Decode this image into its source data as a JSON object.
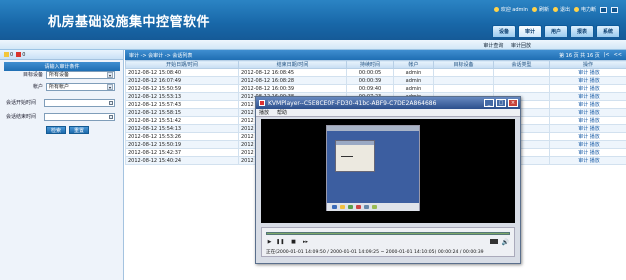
{
  "app": {
    "title": "机房基础设施集中控管软件"
  },
  "topbar": {
    "welcome": "欢迎 admin",
    "refresh": "刷新",
    "logout": "退出",
    "power": "电力断"
  },
  "tabs": [
    "设备",
    "审计",
    "用户",
    "报表",
    "系统"
  ],
  "subnav": {
    "item1": "审计查询",
    "item2": "审计回放"
  },
  "left": {
    "badge1": "0",
    "badge2": "0",
    "panel_title": "请输入审计条件",
    "device_label": "目标设备",
    "device_value": "所有设备",
    "account_label": "帐户",
    "account_value": "所有帐户",
    "start_label": "会话开始时间",
    "end_label": "会话结束时间",
    "search_btn": "检索",
    "reset_btn": "重置"
  },
  "main": {
    "breadcrumb": "审计 -> 会审计 -> 会话列表",
    "pager": "第 16 页 共 16 页",
    "first": "|<",
    "prev": "<<"
  },
  "table": {
    "headers": [
      "开始日期/时间",
      "结束日期/时间",
      "持续时间",
      "帐户",
      "目标设备",
      "会话类型",
      "操作"
    ],
    "rows": [
      [
        "2012-08-12 15:08:40",
        "2012-08-12 16:08:45",
        "00:00:05",
        "admin",
        "",
        "",
        "审计 播放"
      ],
      [
        "2012-08-12 16:07:49",
        "2012-08-12 16:08:28",
        "00:00:39",
        "admin",
        "",
        "",
        "审计 播放"
      ],
      [
        "2012-08-12 15:50:59",
        "2012-08-12 16:00:39",
        "00:09:40",
        "admin",
        "",
        "",
        "审计 播放"
      ],
      [
        "2012-08-12 15:53:13",
        "2012-08-12 16:00:38",
        "00:07:23",
        "admin",
        "",
        "",
        "审计 播放"
      ],
      [
        "2012-08-12 15:57:43",
        "2012",
        "",
        "",
        "",
        "",
        "审计 播放"
      ],
      [
        "2012-08-12 15:58:15",
        "2012",
        "",
        "",
        "",
        "",
        "审计 播放"
      ],
      [
        "2012-08-12 15:51:42",
        "2012",
        "",
        "",
        "",
        "",
        "审计 播放"
      ],
      [
        "2012-08-12 15:54:13",
        "2012",
        "",
        "",
        "",
        "",
        "审计 播放"
      ],
      [
        "2012-08-12 15:53:26",
        "2012",
        "",
        "",
        "",
        "",
        "审计 播放"
      ],
      [
        "2012-08-12 15:50:19",
        "2012",
        "",
        "",
        "",
        "",
        "审计 播放"
      ],
      [
        "2012-08-12 15:42:37",
        "2012",
        "",
        "",
        "",
        "",
        "审计 播放"
      ],
      [
        "2012-08-12 15:40:24",
        "2012",
        "",
        "",
        "",
        "",
        "审计 播放"
      ]
    ]
  },
  "player": {
    "title": "KVMPlayer--C5E8CE0F-FD30-41bc-ABF9-C7DE2A864686",
    "menu_play": "播放",
    "menu_help": "帮助",
    "status": "正在(2000-01-01 14:09:50 / 2000-01-01 14:09:25 ~ 2000-01-01 14:10:05)   00:00:24 / 00:00:39"
  }
}
